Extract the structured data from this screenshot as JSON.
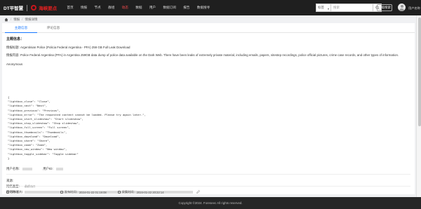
{
  "header": {
    "logo_text": "DT平智慧",
    "brand_text": "海峡要点",
    "nav": [
      "首页",
      "情报",
      "节点",
      "群组",
      "动态",
      "数据",
      "用户",
      "数据订阅",
      "报告",
      "数据搜寻"
    ],
    "active_nav_index": 4,
    "search_select": "标签",
    "search_placeholder": "搜索",
    "advanced_label": "高级搜索",
    "user_name": "用户名称"
  },
  "breadcrumb": {
    "items": [
      "情报",
      "情报详情"
    ]
  },
  "tabs": [
    {
      "label": "主题信息"
    },
    {
      "label": "评论信息"
    }
  ],
  "content": {
    "section_title": "主题信息：",
    "title_label": "情报标题:",
    "title_value": "Argentinian Police (Policia Federal Argentina - PFA) 259 GB Full Leak Download",
    "content_label": "情报内容:",
    "content_value": "Police Federal Argentina (PFA) in Argentina 259GB data dump of police data available on the Dark Web. There have been leaks of extremely private material, including emails, papers, sitestep recordings, police official pictures, crime case records, and other types of information.",
    "author": "Anonymous",
    "code_lines": [
      "{",
      "\"lightbox_close\": \"Close\",",
      "\"lightbox_next\": \"Next\",",
      "\"lightbox_previous\": \"Previous\",",
      "\"lightbox_error\": \"The requested content cannot be loaded. Please try again later.\",",
      "\"lightbox_start_slideshow\": \"Start slideshow\",",
      "\"lightbox_stop_slideshow\": \"Stop slideshow\",",
      "\"lightbox_full_screen\": \"Full screen\",",
      "\"lightbox_thumbnails\": \"Thumbnails\",",
      "\"lightbox_download\": \"Download\",",
      "\"lightbox_share\": \"Share\",",
      "\"lightbox_zoom\": \"Zoom\",",
      "\"lightbox_new_window\": \"New window\",",
      "\"lightbox_toggle_sidebar\": \"Toggle sidebar\"",
      "}"
    ],
    "user_name_label": "用户名称:",
    "user_id_label": "用户ID:",
    "source_label": "来源:",
    "site_type_label": "网络类型:",
    "site_type_value": "darknet",
    "source_url_label": "原始地址:"
  },
  "footer_row": {
    "publisher_label": "发布机构:",
    "publish_time_label": "发布时间:",
    "publish_time_value": "2024-01-22 01:19:08",
    "collect_time_label": "采集时间:",
    "collect_time_value": "2024-01-22 20:22:14"
  },
  "copyright": "Copyright ©2024. Foreseec All rights reserved."
}
